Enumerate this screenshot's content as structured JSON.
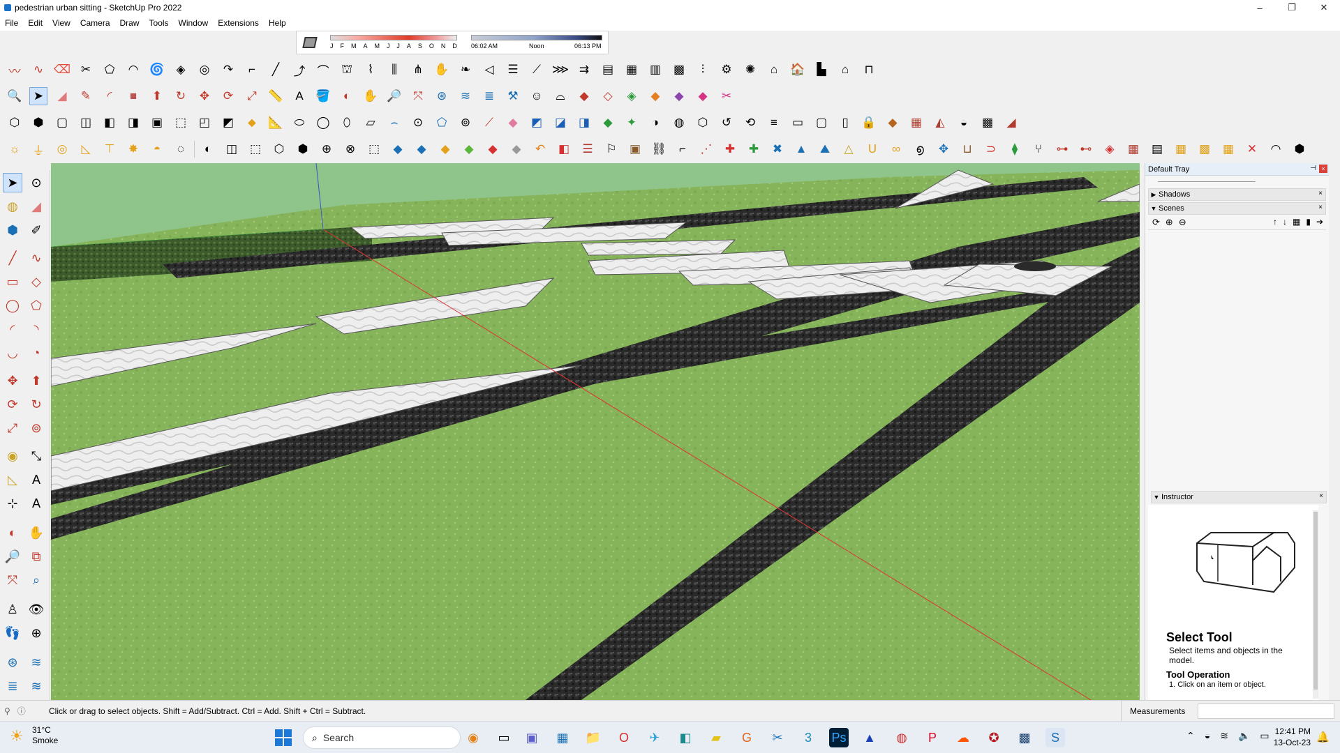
{
  "window": {
    "title": "pedestrian urban sitting - SketchUp Pro 2022",
    "minimize": "–",
    "maximize": "❐",
    "close": "✕"
  },
  "menu": [
    "File",
    "Edit",
    "View",
    "Camera",
    "Draw",
    "Tools",
    "Window",
    "Extensions",
    "Help"
  ],
  "shadow": {
    "months": [
      "J",
      "F",
      "M",
      "A",
      "M",
      "J",
      "J",
      "A",
      "S",
      "O",
      "N",
      "D"
    ],
    "time_start": "06:02 AM",
    "time_noon": "Noon",
    "time_end": "06:13 PM"
  },
  "tray": {
    "title": "Default Tray",
    "pin": "⊣",
    "close": "×",
    "panels": {
      "shadows": "Shadows",
      "scenes": "Scenes",
      "instructor": "Instructor"
    },
    "instructor": {
      "title": "Select Tool",
      "description": "Select items and objects in the model.",
      "operation_heading": "Tool Operation",
      "step1": "1. Click on an item or object."
    }
  },
  "status": {
    "text": "Click or drag to select objects. Shift = Add/Subtract. Ctrl = Add. Shift + Ctrl = Subtract.",
    "measurements_label": "Measurements"
  },
  "taskbar": {
    "weather_temp": "31°C",
    "weather_desc": "Smoke",
    "search_label": "Search",
    "time": "12:41 PM",
    "date": "13-Oct-23"
  },
  "colors": {
    "grass": "#8fc58c",
    "gravel": "#2e2e2e",
    "stone": "#e8e8e8",
    "hedge": "#3f5a2e",
    "accent": "#1c79d8"
  }
}
